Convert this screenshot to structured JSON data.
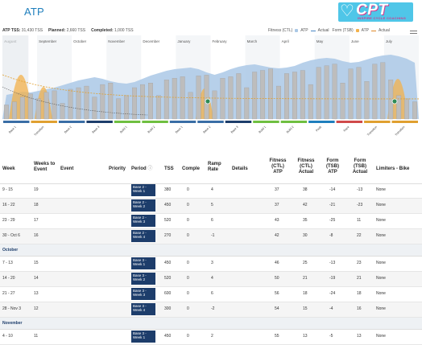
{
  "app_title": "ATP",
  "logo": {
    "text": "CPT",
    "subtext": "INSPIRE CYCLE COACHING"
  },
  "summary": {
    "atp_tss_label": "ATP TSS:",
    "atp_tss_value": "31,430 TSS",
    "planned_label": "Planned:",
    "planned_value": "2,660 TSS",
    "completed_label": "Completed:",
    "completed_value": "1,000 TSS"
  },
  "legend": {
    "fitness_label": "Fitness (CTL)",
    "fitness_atp": "ATP",
    "fitness_actual": "Actual",
    "form_label": "Form (TSB)",
    "form_atp": "ATP",
    "form_actual": "Actual"
  },
  "colors": {
    "accent": "#1f7fbd",
    "fitness_bar": "#aac8e6",
    "tss_bar": "#bdbdbd",
    "form_fill": "#f3b24b",
    "period_bg": "#1d3d6b"
  },
  "chart_data": {
    "type": "bar",
    "months": [
      "August",
      "September",
      "October",
      "November",
      "December",
      "January",
      "February",
      "March",
      "April",
      "May",
      "June",
      "July"
    ],
    "phase_labels": [
      "Base 1",
      "Transition",
      "Base 2",
      "Base 3",
      "Build 1",
      "Build 2",
      "Base 1",
      "Base 2",
      "Base 3",
      "Build 1",
      "Build 2",
      "Peak",
      "Race",
      "Transition",
      "Transition"
    ],
    "phase_colors": [
      "#3a6ea5",
      "#e0a030",
      "#3a6ea5",
      "#1d3d6b",
      "#6fbf40",
      "#6fbf40",
      "#3a6ea5",
      "#3a6ea5",
      "#1d3d6b",
      "#6fbf40",
      "#6fbf40",
      "#1f7fbd",
      "#d04a4a",
      "#e0a030",
      "#e0a030"
    ],
    "fitness": [
      30,
      32,
      34,
      33,
      35,
      37,
      39,
      42,
      45,
      48,
      50,
      52,
      50,
      47,
      45,
      44,
      46,
      50,
      54,
      57,
      60,
      62,
      63,
      64,
      62,
      58,
      55,
      58,
      62,
      65,
      67,
      68,
      66,
      64,
      63,
      64,
      66,
      70,
      73,
      75,
      76,
      75,
      72,
      70,
      71,
      74,
      77,
      79,
      80,
      78,
      75,
      70
    ],
    "tss": [
      18,
      22,
      28,
      32,
      26,
      34,
      36,
      20,
      38,
      40,
      42,
      28,
      44,
      46,
      26,
      30,
      40,
      44,
      46,
      30,
      50,
      52,
      54,
      34,
      55,
      56,
      36,
      52,
      54,
      58,
      40,
      60,
      62,
      64,
      42,
      58,
      60,
      62,
      44,
      66,
      68,
      70,
      46,
      64,
      66,
      48,
      70,
      72,
      50,
      30,
      26,
      22
    ]
  },
  "table": {
    "headers": {
      "week": "Week",
      "weeks_to_event": "Weeks to Event",
      "event": "Event",
      "priority": "Priority",
      "period": "Period",
      "tss": "TSS",
      "compl": "Comple",
      "ramp_rate": "Ramp Rate",
      "details": "Details",
      "fitness_atp": "Fitness (CTL) ATP",
      "fitness_actual": "Fitness (CTL) Actual",
      "form_atp": "Form (TSB) ATP",
      "form_actual": "Form (TSB) Actual",
      "limiters": "Limiters - Bike"
    },
    "groups": [
      {
        "month": "",
        "rows": [
          {
            "week": "9 - 15",
            "weeks": "19",
            "period": "Base 2 - Week 1",
            "tss": "380",
            "compl": "0",
            "ramp": "4",
            "fit_atp": "37",
            "fit_act": "38",
            "form_atp": "-14",
            "form_act": "-13",
            "lim": "None"
          },
          {
            "week": "16 - 22",
            "weeks": "18",
            "period": "Base 2 - Week 2",
            "tss": "450",
            "compl": "0",
            "ramp": "5",
            "fit_atp": "37",
            "fit_act": "42",
            "form_atp": "-21",
            "form_act": "-23",
            "lim": "None"
          },
          {
            "week": "23 - 29",
            "weeks": "17",
            "period": "Base 2 - Week 3",
            "tss": "520",
            "compl": "0",
            "ramp": "6",
            "fit_atp": "43",
            "fit_act": "35",
            "form_atp": "-25",
            "form_act": "11",
            "lim": "None"
          },
          {
            "week": "30 - Oct 6",
            "weeks": "16",
            "period": "Base 2 - Week 4",
            "tss": "270",
            "compl": "0",
            "ramp": "-1",
            "fit_atp": "42",
            "fit_act": "30",
            "form_atp": "-8",
            "form_act": "22",
            "lim": "None"
          }
        ]
      },
      {
        "month": "October",
        "rows": [
          {
            "week": "7 - 13",
            "weeks": "15",
            "period": "Base 3 - Week 1",
            "tss": "450",
            "compl": "0",
            "ramp": "3",
            "fit_atp": "46",
            "fit_act": "25",
            "form_atp": "-13",
            "form_act": "23",
            "lim": "None"
          },
          {
            "week": "14 - 20",
            "weeks": "14",
            "period": "Base 3 - Week 2",
            "tss": "520",
            "compl": "0",
            "ramp": "4",
            "fit_atp": "50",
            "fit_act": "21",
            "form_atp": "-19",
            "form_act": "21",
            "lim": "None"
          },
          {
            "week": "21 - 27",
            "weeks": "13",
            "period": "Base 3 - Week 3",
            "tss": "600",
            "compl": "0",
            "ramp": "6",
            "fit_atp": "56",
            "fit_act": "18",
            "form_atp": "-24",
            "form_act": "18",
            "lim": "None"
          },
          {
            "week": "28 - Nov 3",
            "weeks": "12",
            "period": "Base 3 - Week 4",
            "tss": "300",
            "compl": "0",
            "ramp": "-2",
            "fit_atp": "54",
            "fit_act": "15",
            "form_atp": "-4",
            "form_act": "16",
            "lim": "None"
          }
        ]
      },
      {
        "month": "November",
        "rows": [
          {
            "week": "4 - 10",
            "weeks": "11",
            "period": "Base 3 - Week 1",
            "tss": "450",
            "compl": "0",
            "ramp": "2",
            "fit_atp": "55",
            "fit_act": "13",
            "form_atp": "-5",
            "form_act": "13",
            "lim": "None"
          }
        ]
      }
    ]
  }
}
